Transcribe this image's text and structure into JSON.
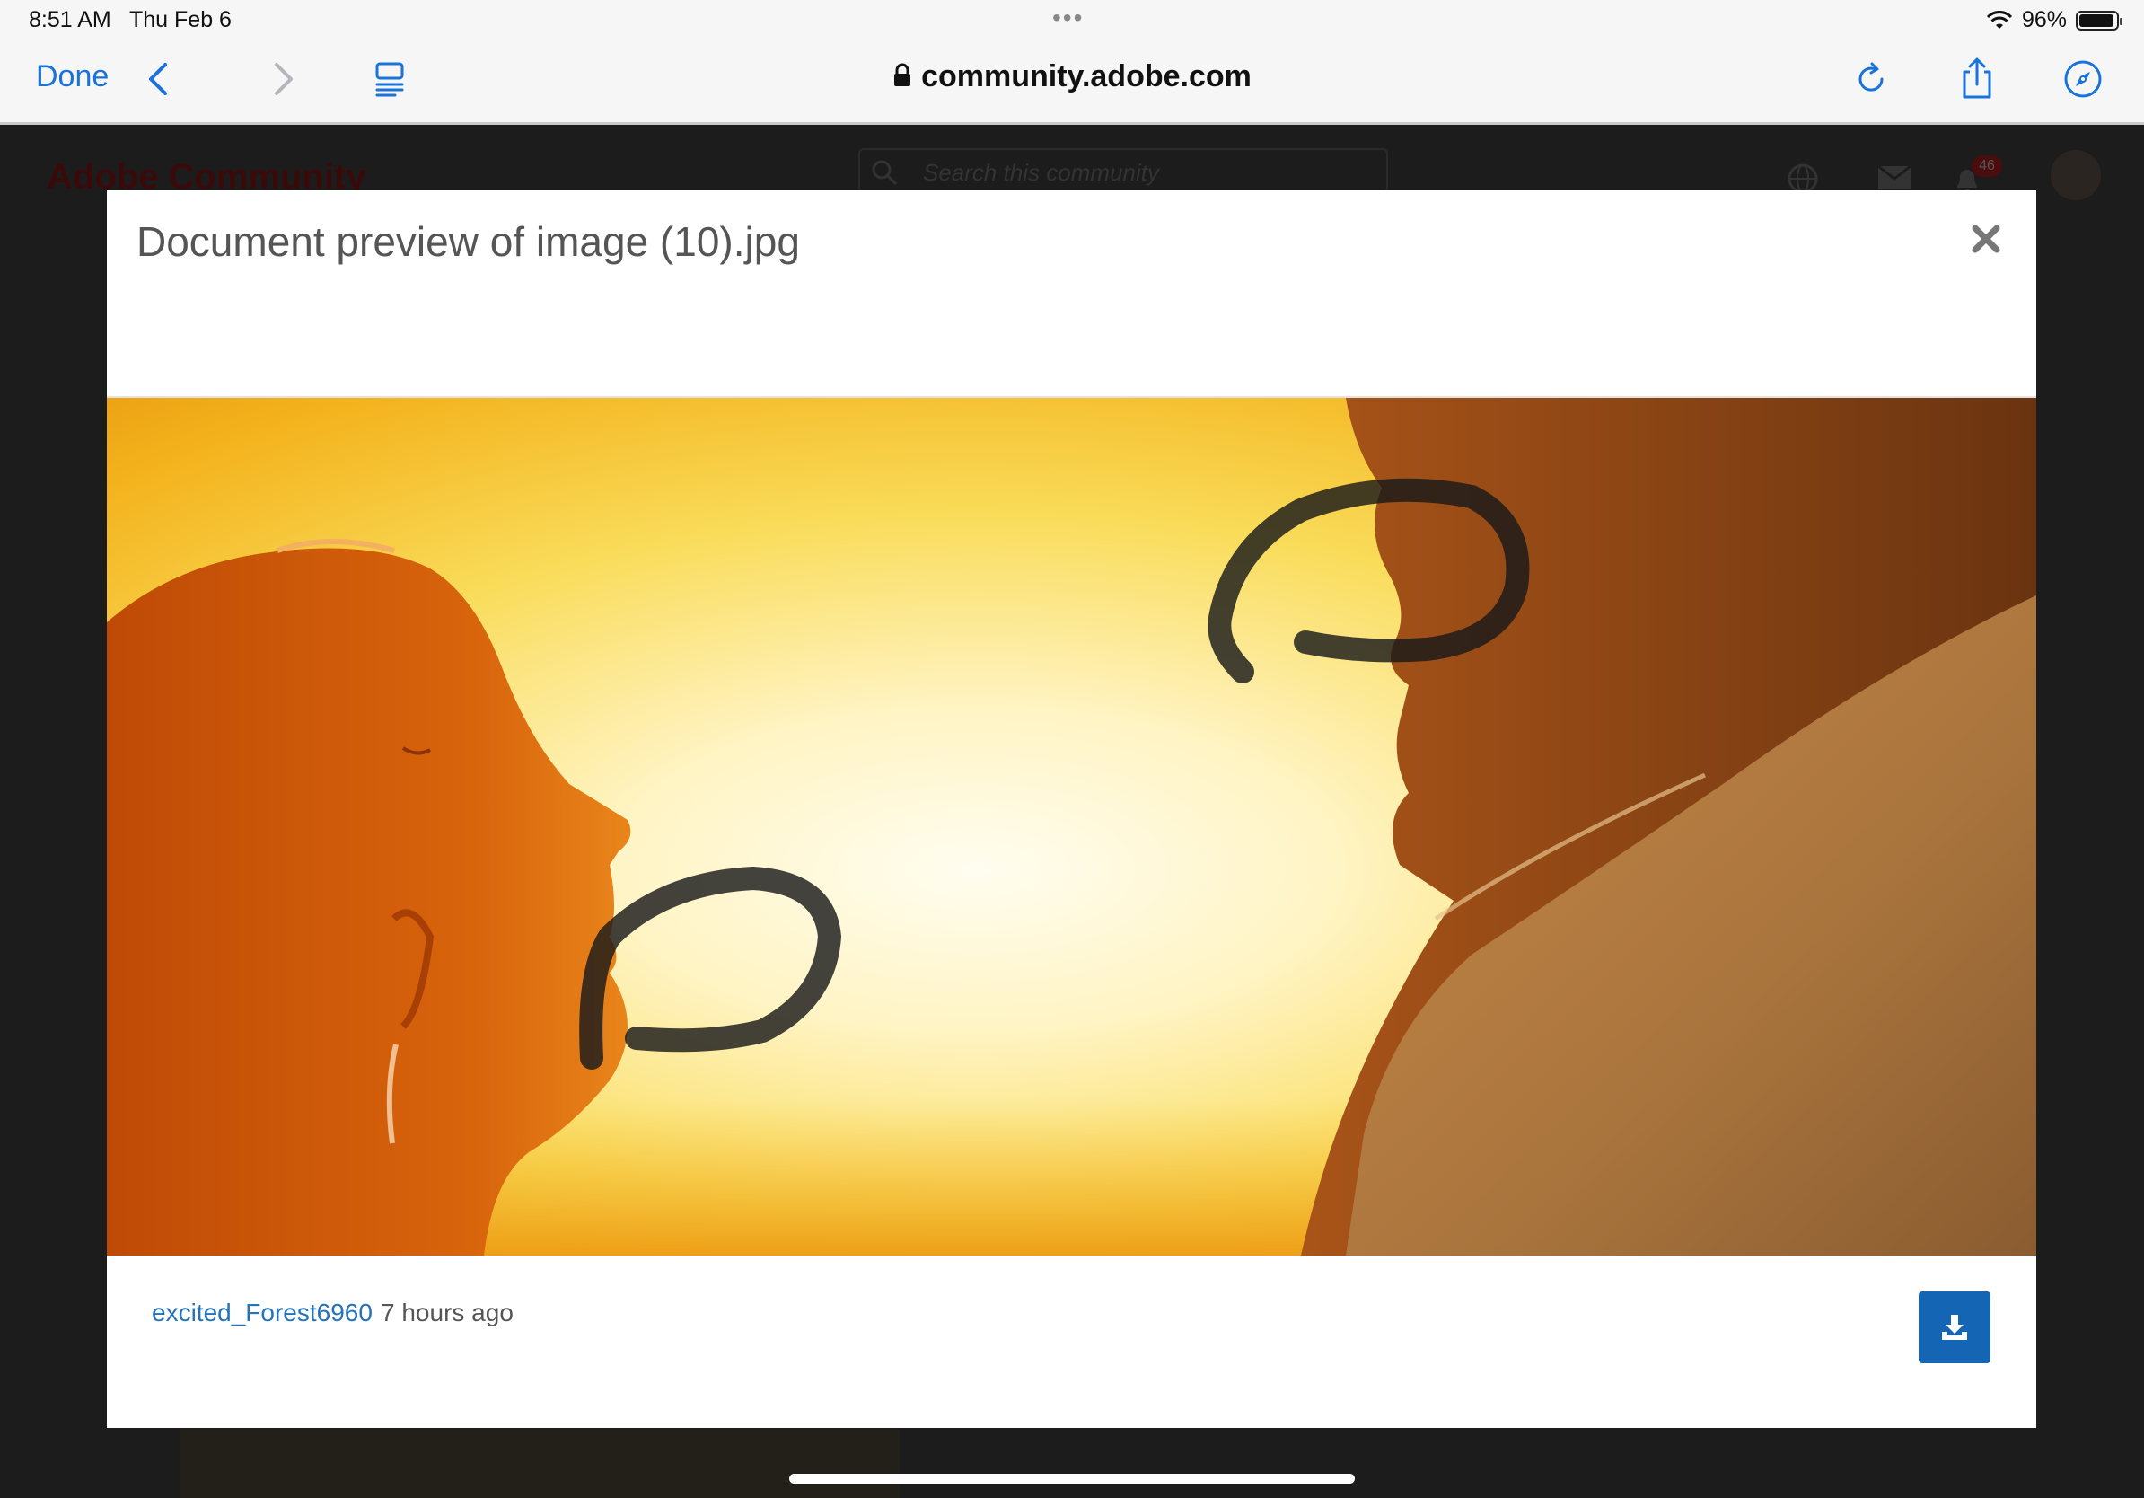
{
  "status_bar": {
    "time": "8:51 AM",
    "date": "Thu Feb 6",
    "battery": "96%",
    "multitask_dots": "•••"
  },
  "browser": {
    "done_label": "Done",
    "url": "community.adobe.com",
    "accent_color": "#1a73d9"
  },
  "background_page": {
    "logo": "Adobe Community",
    "search_placeholder": "Search this community",
    "notification_count": "46"
  },
  "modal": {
    "title": "Document preview of image (10).jpg",
    "author": "excited_Forest6960",
    "time_ago": "7 hours ago",
    "download_color": "#1565b5"
  }
}
